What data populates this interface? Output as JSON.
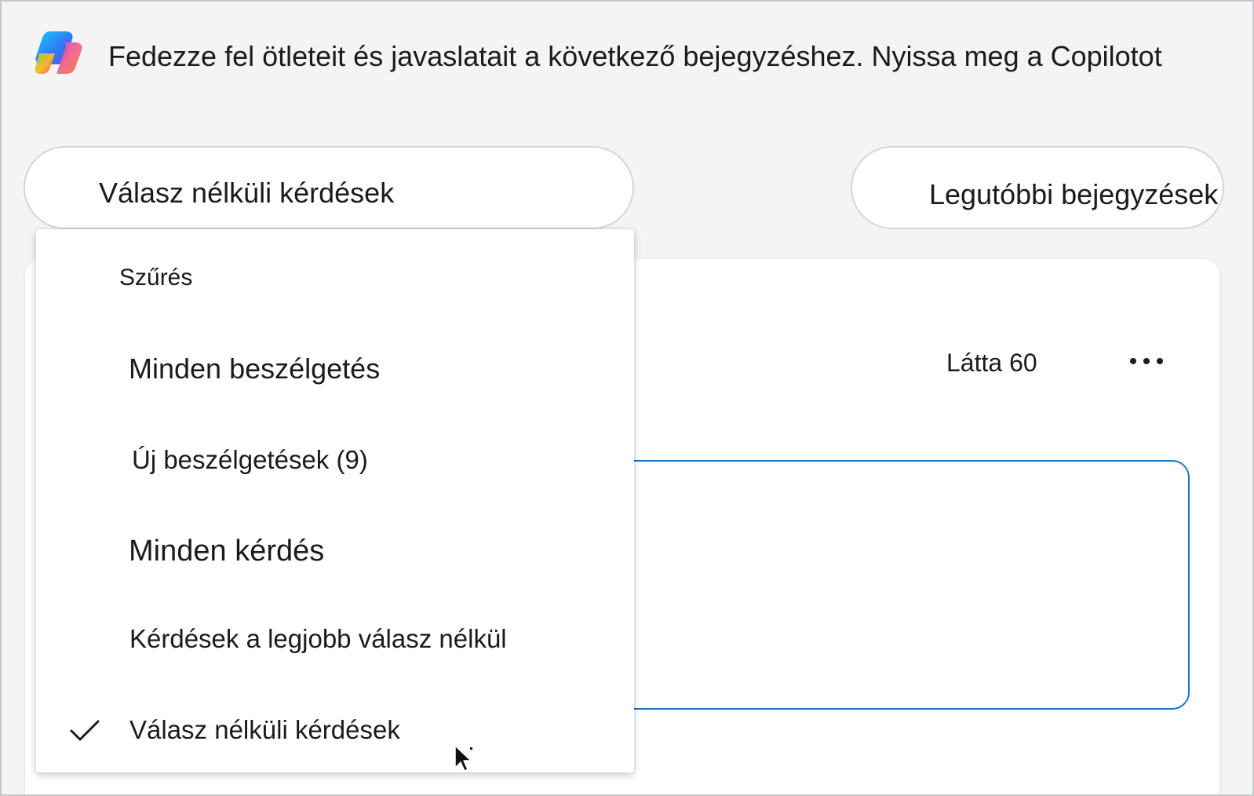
{
  "banner": {
    "logo_icon": "copilot-logo-icon",
    "text": "Fedezze fel ötleteit és javaslatait a következő bejegyzéshez. Nyissa meg a Copilotot"
  },
  "filter_pill": {
    "label": "Válasz nélküli kérdések"
  },
  "sort_pill": {
    "label": "Legutóbbi bejegyzések"
  },
  "post": {
    "seen_label": "Látta 60",
    "more_icon": "more-horizontal-icon"
  },
  "dropdown": {
    "header": "Szűrés",
    "items": [
      {
        "label": "Minden beszélgetés",
        "checked": false
      },
      {
        "label": "Új beszélgetések (9)",
        "checked": false
      },
      {
        "label": "Minden kérdés",
        "checked": false
      },
      {
        "label": "Kérdések a legjobb válasz nélkül",
        "checked": false
      },
      {
        "label": "Válasz nélküli kérdések",
        "checked": true
      }
    ],
    "check_icon": "checkmark-icon"
  },
  "colors": {
    "page_background": "#f4f4f4",
    "surface": "#ffffff",
    "focus_border": "#1a73c8",
    "text": "#1b1b1b"
  }
}
